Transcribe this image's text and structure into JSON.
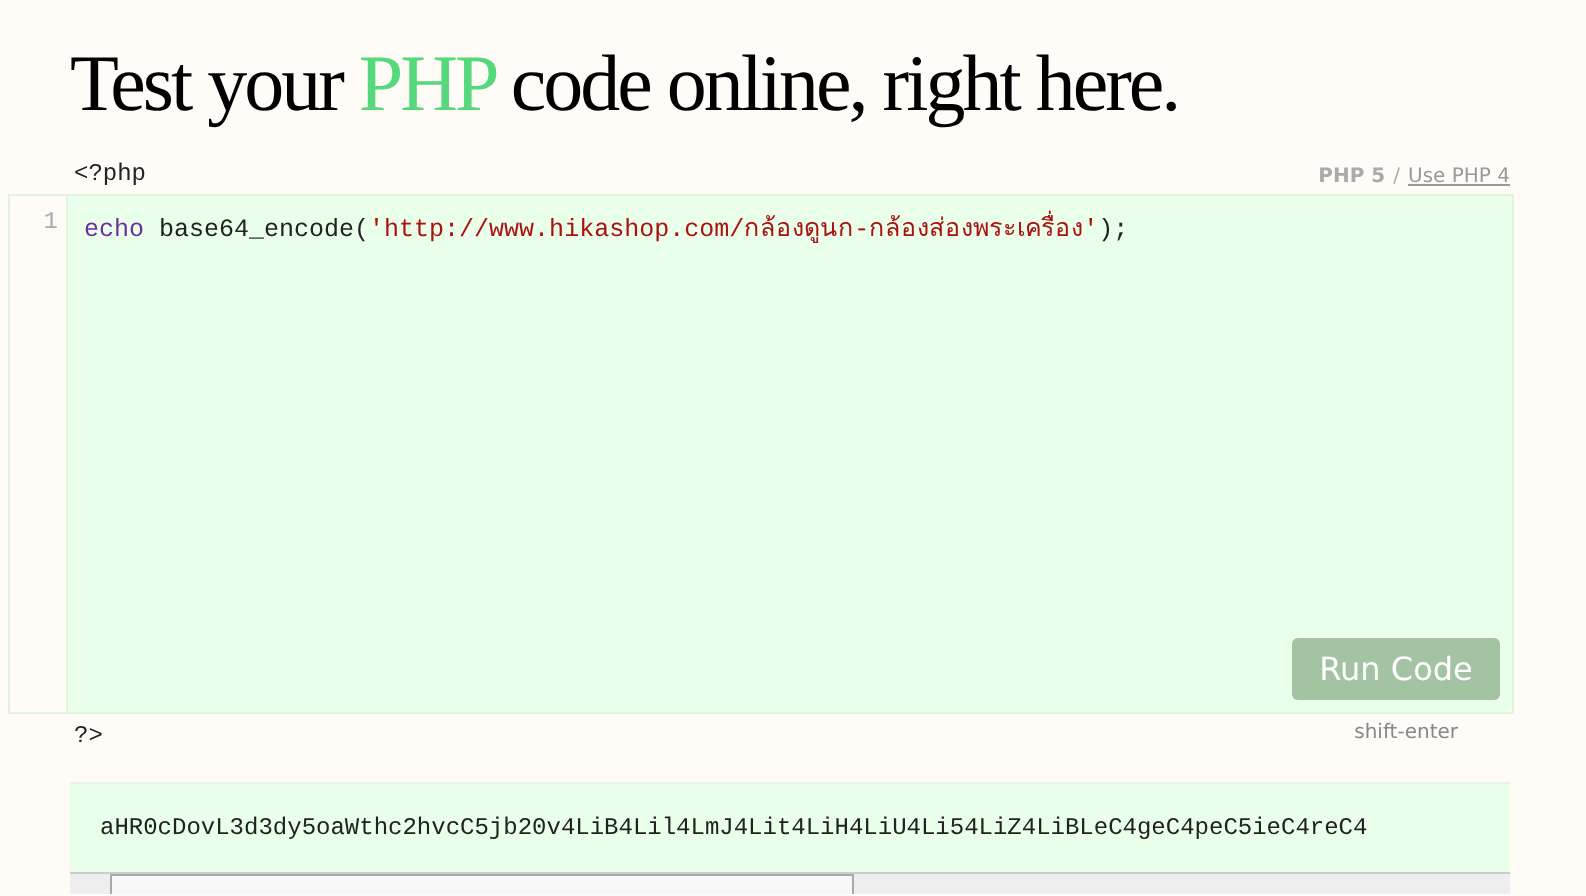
{
  "heading": {
    "before": "Test your ",
    "highlight": "PHP",
    "after": " code online, right here."
  },
  "open_tag": "<?php",
  "version": {
    "current": "PHP 5",
    "separator": "/",
    "link": "Use PHP 4"
  },
  "editor": {
    "lines": [
      {
        "number": "1",
        "keyword": "echo",
        "call": " base64_encode(",
        "string": "'http://www.hikashop.com/กล้องดูนก-กล้องส่องพระเครื่อง'",
        "end": ");"
      }
    ]
  },
  "run_button": {
    "label": "Run Code",
    "disabled": true
  },
  "shortcut": "shift-enter",
  "close_tag": "?>",
  "output": "aHR0cDovL3d3dy5oaWthc2hvcC5jb20v4LiB4Lil4LmJ4Lit4LiH4LiU4Li54LiZ4LiBLeC4geC4peC5ieC4reC4"
}
